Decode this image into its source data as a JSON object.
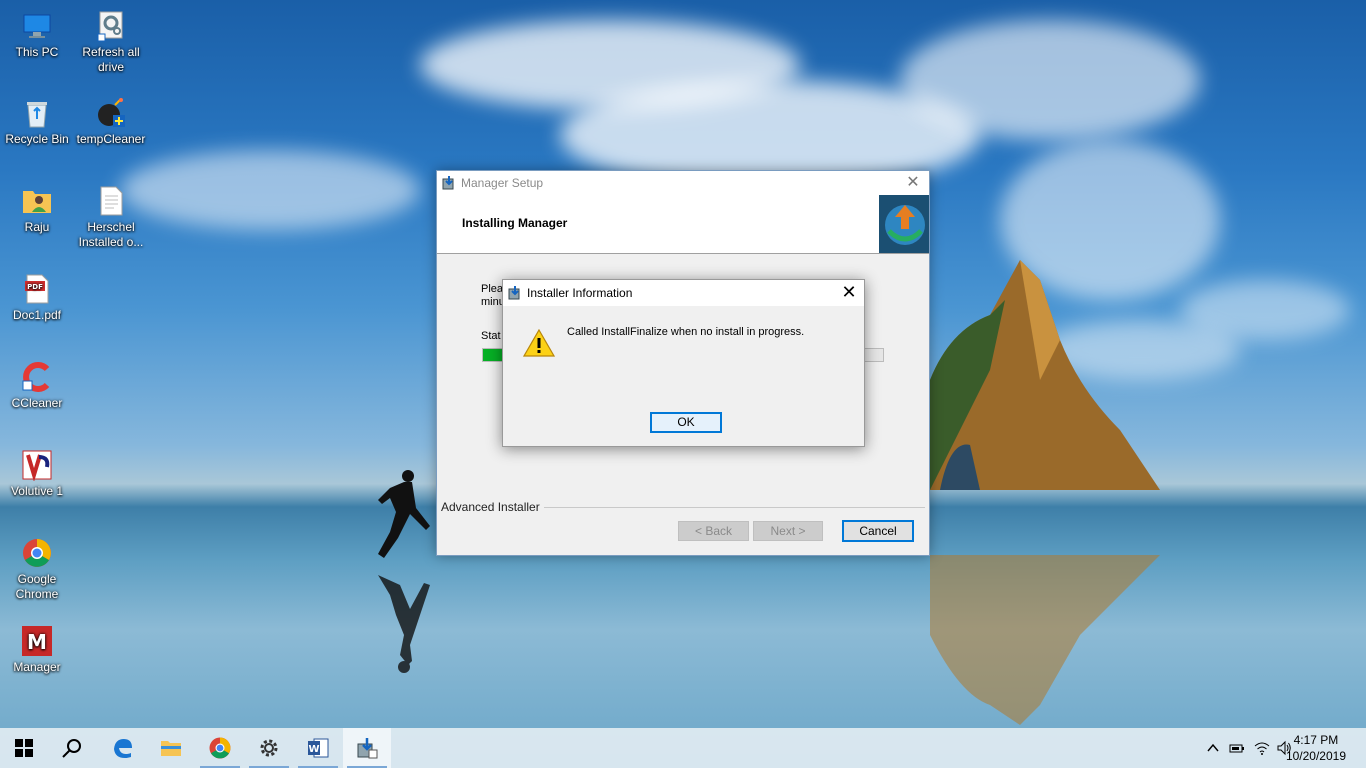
{
  "desktop_icons": [
    {
      "label": "This PC",
      "icon": "computer-icon"
    },
    {
      "label": "Refresh all drive",
      "icon": "gear-doc-icon"
    },
    {
      "label": "Recycle Bin",
      "icon": "recycle-bin-icon"
    },
    {
      "label": "tempCleaner",
      "icon": "bomb-icon"
    },
    {
      "label": "Raju",
      "icon": "user-folder-icon"
    },
    {
      "label": "Herschel Installed o...",
      "icon": "text-file-icon"
    },
    {
      "label": "Doc1.pdf",
      "icon": "pdf-icon"
    },
    {
      "label": "CCleaner",
      "icon": "ccleaner-icon"
    },
    {
      "label": "Volutive 1",
      "icon": "volutive-icon"
    },
    {
      "label": "Google Chrome",
      "icon": "chrome-icon"
    },
    {
      "label": "Manager",
      "icon": "manager-app-icon"
    }
  ],
  "setup_window": {
    "title": "Manager Setup",
    "heading": "Installing Manager",
    "body_line1": "Pleas",
    "body_line2": "minu",
    "status_label": "Stat",
    "progress": 0.06,
    "brand": "Advanced Installer",
    "back_label": "< Back",
    "next_label": "Next >",
    "cancel_label": "Cancel",
    "close_glyph": "✕"
  },
  "message_box": {
    "title": "Installer Information",
    "message": "Called InstallFinalize when no install in progress.",
    "ok_label": "OK",
    "close_glyph": "✕"
  },
  "taskbar": {
    "apps": [
      "start-icon",
      "search-icon",
      "edge-icon",
      "file-explorer-icon",
      "chrome-icon",
      "settings-icon",
      "word-icon",
      "installer-icon"
    ],
    "time": "4:17 PM",
    "date": "10/20/2019"
  },
  "colors": {
    "progress_fill": "#06b025",
    "accent": "#0078d7"
  }
}
